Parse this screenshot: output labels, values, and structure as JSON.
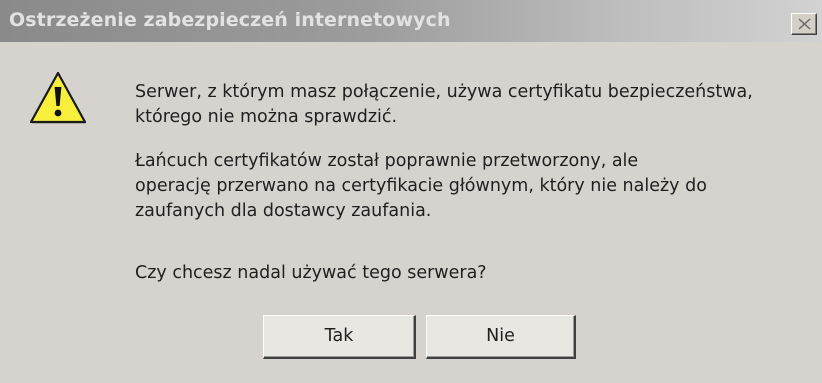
{
  "dialog": {
    "title": "Ostrzeżenie zabezpieczeń internetowych",
    "close_glyph": "✕",
    "icon": "warning-icon",
    "message_lines": [
      "Serwer, z którym masz połączenie, używa certyfikatu bezpieczeństwa,",
      "którego nie można sprawdzić.",
      "Łańcuch certyfikatów został poprawnie przetworzony, ale",
      "operację przerwano na certyfikacie głównym, który nie należy do",
      "zaufanych dla dostawcy zaufania.",
      "Czy chcesz nadal używać tego serwera?"
    ],
    "buttons": {
      "yes": "Tak",
      "no": "Nie"
    }
  },
  "colors": {
    "window_background": "#d6d3ce",
    "title_text": "#e2e2e2",
    "warning_fill": "#f7ef3b",
    "text": "#1f1f1f"
  }
}
